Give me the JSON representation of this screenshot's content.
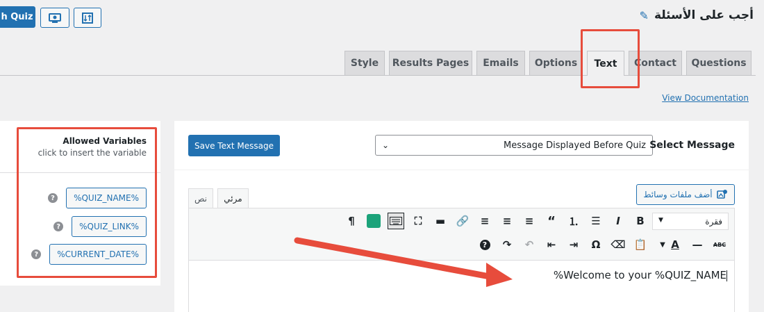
{
  "header": {
    "launch_label": "h Quiz",
    "page_title": "أجب على الأسئلة",
    "pencil_icon": "pencil-icon",
    "preview_icon": "eye-icon",
    "sort_icon": "sort-icon"
  },
  "tabs": [
    {
      "label": "Style"
    },
    {
      "label": "Results Pages"
    },
    {
      "label": "Emails"
    },
    {
      "label": "Options"
    },
    {
      "label": "Text"
    },
    {
      "label": "Contact"
    },
    {
      "label": "Questions"
    }
  ],
  "active_tab": "Text",
  "view_documentation": "View Documentation",
  "variables": {
    "title": "Allowed Variables",
    "subtitle": "click to insert the variable",
    "items": [
      "%QUIZ_NAME%",
      "%QUIZ_LINK%",
      "%CURRENT_DATE%"
    ]
  },
  "message": {
    "save_label": "Save Text Message",
    "select_label": "Select Message",
    "selected": "Message Displayed Before Quiz"
  },
  "editor": {
    "add_media": "أضف ملفات وسائط",
    "tab_visual": "مرئي",
    "tab_text": "نص",
    "format": "فقرة",
    "content": "%Welcome to your %QUIZ_NAME"
  },
  "colors": {
    "accent": "#2271b1",
    "highlight": "#e74c3c"
  }
}
